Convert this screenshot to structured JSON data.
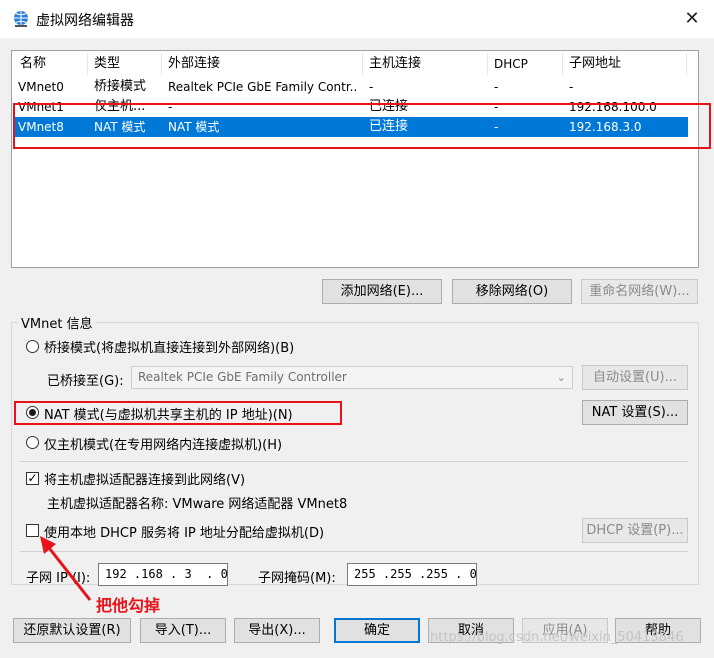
{
  "window": {
    "title": "虚拟网络编辑器",
    "close_symbol": "✕"
  },
  "table": {
    "columns": [
      "名称",
      "类型",
      "外部连接",
      "主机连接",
      "DHCP",
      "子网地址"
    ],
    "rows": [
      [
        "VMnet0",
        "桥接模式",
        "Realtek PCIe GbE Family Contr...",
        "-",
        "-",
        "-"
      ],
      [
        "VMnet1",
        "仅主机...",
        "-",
        "已连接",
        "-",
        "192.168.100.0"
      ],
      [
        "VMnet8",
        "NAT 模式",
        "NAT 模式",
        "已连接",
        "-",
        "192.168.3.0"
      ]
    ],
    "selected_row": 2
  },
  "table_buttons": {
    "add": "添加网络(E)...",
    "remove": "移除网络(O)",
    "rename": "重命名网络(W)..."
  },
  "vmnet_info": {
    "group_label": "VMnet 信息",
    "bridged": "桥接模式(将虚拟机直接连接到外部网络)(B)",
    "bridged_to_label": "已桥接至(G):",
    "bridged_to_value": "Realtek PCIe GbE Family Controller",
    "auto_settings": "自动设置(U)...",
    "nat": "NAT 模式(与虚拟机共享主机的 IP 地址)(N)",
    "nat_settings": "NAT 设置(S)...",
    "host_only": "仅主机模式(在专用网络内连接虚拟机)(H)",
    "connect_adapter": "将主机虚拟适配器连接到此网络(V)",
    "adapter_name": "主机虚拟适配器名称: VMware 网络适配器 VMnet8",
    "use_dhcp": "使用本地 DHCP 服务将 IP 地址分配给虚拟机(D)",
    "dhcp_settings": "DHCP 设置(P)...",
    "subnet_ip_label": "子网 IP (I):",
    "subnet_ip_value": "192 .168 . 3  . 0",
    "subnet_mask_label": "子网掩码(M):",
    "subnet_mask_value": "255 .255 .255 . 0",
    "selected_mode": "nat",
    "connect_adapter_checked": true,
    "use_dhcp_checked": false
  },
  "annotation": {
    "text": "把他勾掉",
    "color": "#e8121a"
  },
  "footer_buttons": {
    "restore": "还原默认设置(R)",
    "import": "导入(T)...",
    "export": "导出(X)...",
    "ok": "确定",
    "cancel": "取消",
    "apply": "应用(A)",
    "help": "帮助"
  },
  "watermark": "https://blog.csdn.net/weixin_50413846",
  "colors": {
    "selection": "#0078d7",
    "highlight_box": "#e8121a"
  }
}
